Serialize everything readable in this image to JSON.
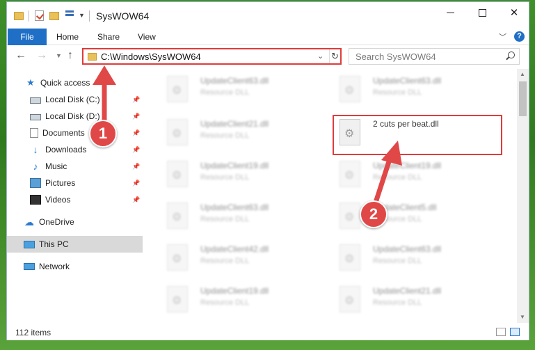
{
  "window": {
    "title": "SysWOW64"
  },
  "ribbon": {
    "tabs": [
      "File",
      "Home",
      "Share",
      "View"
    ],
    "help": "?"
  },
  "nav": {
    "address": "C:\\Windows\\SysWOW64",
    "search_placeholder": "Search SysWOW64"
  },
  "sidebar": {
    "items": [
      {
        "label": "Quick access",
        "icon": "star-icon",
        "pinned": false
      },
      {
        "label": "Local Disk (C:)",
        "icon": "disk-icon",
        "pinned": true
      },
      {
        "label": "Local Disk (D:)",
        "icon": "disk-icon",
        "pinned": true
      },
      {
        "label": "Documents",
        "icon": "documents-icon",
        "pinned": true
      },
      {
        "label": "Downloads",
        "icon": "download-icon",
        "pinned": true
      },
      {
        "label": "Music",
        "icon": "music-icon",
        "pinned": true
      },
      {
        "label": "Pictures",
        "icon": "pictures-icon",
        "pinned": true
      },
      {
        "label": "Videos",
        "icon": "videos-icon",
        "pinned": true
      },
      {
        "label": "OneDrive",
        "icon": "cloud-icon",
        "pinned": false
      },
      {
        "label": "This PC",
        "icon": "pc-icon",
        "pinned": false,
        "selected": true
      },
      {
        "label": "Network",
        "icon": "network-icon",
        "pinned": false
      }
    ]
  },
  "files": [
    {
      "name": "UpdateClient63.dll",
      "type": "Resource DLL"
    },
    {
      "name": "UpdateClient63.dll",
      "type": "Resource DLL"
    },
    {
      "name": "UpdateClient21.dll",
      "type": "Resource DLL"
    },
    {
      "name": "2 cuts per beat.dll",
      "type": ""
    },
    {
      "name": "UpdateClient19.dll",
      "type": "Resource DLL"
    },
    {
      "name": "UpdateClient19.dll",
      "type": "Resource DLL"
    },
    {
      "name": "UpdateClient63.dll",
      "type": "Resource DLL"
    },
    {
      "name": "UpdateClient5.dll",
      "type": "Resource DLL"
    },
    {
      "name": "UpdateClient42.dll",
      "type": "Resource DLL"
    },
    {
      "name": "UpdateClient63.dll",
      "type": "Resource DLL"
    },
    {
      "name": "UpdateClient19.dll",
      "type": "Resource DLL"
    },
    {
      "name": "UpdateClient21.dll",
      "type": "Resource DLL"
    }
  ],
  "status": {
    "count": "112 items"
  },
  "annotations": {
    "step1": "1",
    "step2": "2"
  },
  "colors": {
    "accent": "#1f6fc6",
    "highlight": "#e03b3b"
  }
}
